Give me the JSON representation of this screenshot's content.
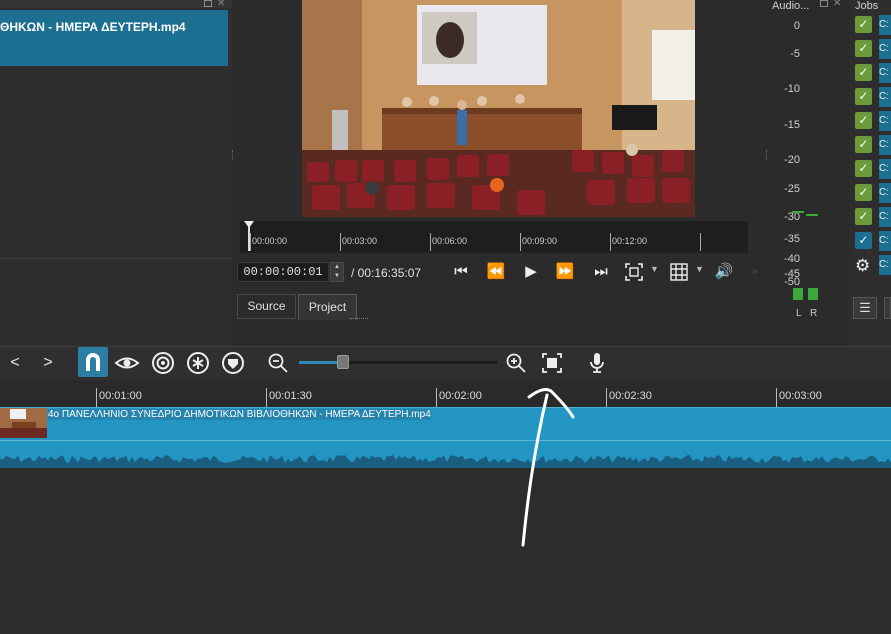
{
  "playlist": {
    "item_label": "ΘΗΚΩΝ - ΗΜΕΡΑ ΔΕΥΤΕΡΗ.mp4"
  },
  "player": {
    "scrubber_ticks": [
      "00:00:00",
      "00:03:00",
      "00:06:00",
      "00:09:00",
      "00:12:00"
    ],
    "timecode": "00:00:00:01",
    "duration": "/ 00:16:35:07",
    "tabs": {
      "source": "Source",
      "project": "Project"
    }
  },
  "audio_meter": {
    "title": "Audio...",
    "db_scale": [
      "0",
      "-5",
      "-10",
      "-15",
      "-20",
      "-25",
      "-30",
      "-35",
      "-40",
      "-45",
      "-50"
    ],
    "channel_left": "L",
    "channel_right": "R",
    "level_color": "#3ca83c"
  },
  "jobs": {
    "title": "Jobs",
    "item_prefix": "C:",
    "checked_count": 10
  },
  "timeline": {
    "ruler_labels": [
      "00:01:00",
      "00:01:30",
      "00:02:00",
      "00:02:30",
      "00:03:00"
    ],
    "clip_name": "4ο ΠΑΝΕΛΛΗΝΙΟ ΣΥΝΕΔΡΙΟ ΔΗΜΟΤΙΚΩΝ ΒΙΒΛΙΟΘΗΚΩΝ - ΗΜΕΡΑ ΔΕΥΤΕΡΗ.mp4",
    "zoom_level": 0.22,
    "accent_color": "#2d7ea4",
    "clip_color": "#2295c2"
  }
}
